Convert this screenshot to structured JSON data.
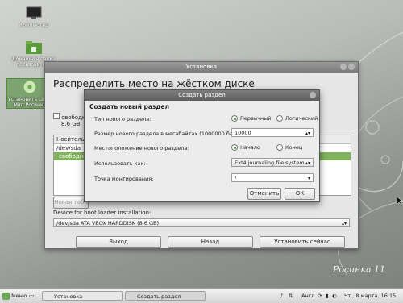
{
  "desktop": {
    "icons": [
      {
        "label": "Компьютер"
      },
      {
        "label": "Домашняя папка пользователя"
      },
      {
        "label": "Установить Linux Mint Росинка"
      }
    ],
    "branding": "Росинка 11"
  },
  "installer": {
    "title": "Установка",
    "heading": "Распределить место на жёстком диске",
    "free_item_label": "свободное",
    "free_item_size": "8.6 GB",
    "table_header": "Носитель",
    "device_row": "/dev/sda",
    "free_row": "свободное",
    "new_table_button": "Новая табл",
    "bootloader_label": "Device for boot loader installation:",
    "bootloader_value": "/dev/sda  ATA VBOX HARDDISK (8.6 GB)",
    "buttons": {
      "quit": "Выход",
      "back": "Назад",
      "install": "Установить сейчас"
    }
  },
  "dialog": {
    "title": "Создать раздел",
    "heading": "Создать новый раздел",
    "type_label": "Тип нового раздела:",
    "type_primary": "Первичный",
    "type_logical": "Логический",
    "size_label": "Размер нового раздела в мегабайтах (1000000 байт):",
    "size_value": "10000",
    "location_label": "Местоположение нового раздела:",
    "location_start": "Начало",
    "location_end": "Конец",
    "use_as_label": "Использовать как:",
    "use_as_value": "Ext4 journaling file system",
    "mount_label": "Точка монтирования:",
    "mount_value": "/",
    "cancel": "Отменить",
    "ok": "ОК"
  },
  "taskbar": {
    "menu": "Меню",
    "tasks": [
      "Установка",
      "Создать раздел"
    ],
    "layout": "Англ",
    "clock": "Чт., 8 марта, 16:15"
  },
  "colors": {
    "accent_green": "#3c7a2c",
    "titlebar": "#7b7b7b"
  }
}
